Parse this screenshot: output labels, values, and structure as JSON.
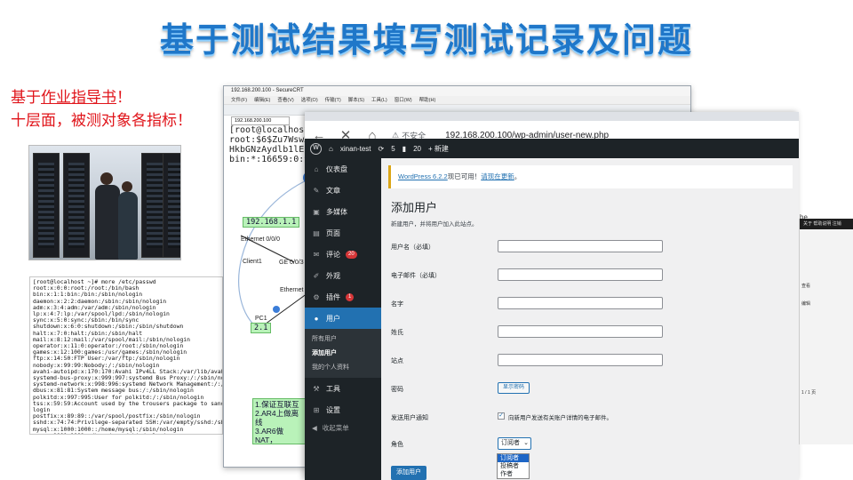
{
  "slide": {
    "title": "基于测试结果填写测试记录及问题",
    "intro_line1_prefix": "基于",
    "intro_line1_link": "作业指导书",
    "intro_line1_suffix": "！",
    "intro_line2": "十层面，被测对象各指标！"
  },
  "terminal_lines": [
    "[root@localhost ~]# more /etc/passwd",
    "root:x:0:0:root:/root:/bin/bash",
    "bin:x:1:1:bin:/bin:/sbin/nologin",
    "daemon:x:2:2:daemon:/sbin:/sbin/nologin",
    "adm:x:3:4:adm:/var/adm:/sbin/nologin",
    "lp:x:4:7:lp:/var/spool/lpd:/sbin/nologin",
    "sync:x:5:0:sync:/sbin:/bin/sync",
    "shutdown:x:6:0:shutdown:/sbin:/sbin/shutdown",
    "halt:x:7:0:halt:/sbin:/sbin/halt",
    "mail:x:8:12:mail:/var/spool/mail:/sbin/nologin",
    "operator:x:11:0:operator:/root:/sbin/nologin",
    "games:x:12:100:games:/usr/games:/sbin/nologin",
    "ftp:x:14:50:FTP User:/var/ftp:/sbin/nologin",
    "nobody:x:99:99:Nobody:/:/sbin/nologin",
    "avahi-autoipd:x:170:170:Avahi IPv4LL Stack:/var/lib/avahi",
    "systemd-bus-proxy:x:999:997:systemd Bus Proxy:/:/sbin/nol",
    "systemd-network:x:998:996:systemd Network Management:/:/",
    "dbus:x:81:81:System message bus:/:/sbin/nologin",
    "polkitd:x:997:995:User for polkitd:/:/sbin/nologin",
    "tss:x:59:59:Account used by the trousers package to sand",
    "login",
    "postfix:x:89:89::/var/spool/postfix:/sbin/nologin",
    "sshd:x:74:74:Privilege-separated SSH:/var/empty/sshd:/sb",
    "mysql:x:1000:1000::/home/mysql:/sbin/nologin",
    "www:x:1001:1001::/home/www:/sbin/nologin",
    "ntp:x:38:38::/etc/ntp:/sbin/nologin",
    "saslauth:x:996:76:Saslauthd user:/run/saslauthd:/sbin/no",
    "[root@localhost ~]# "
  ],
  "securecrt": {
    "title": "192.168.200.100 - SecureCRT",
    "menu": [
      "文件(F)",
      "编辑(E)",
      "查看(V)",
      "选项(O)",
      "传输(T)",
      "脚本(S)",
      "工具(L)",
      "窗口(W)",
      "帮助(H)"
    ],
    "tab": "192.168.200.100",
    "term_text": "[root@localhost ~]# cat\nroot:$6$Zu7WswXx\nHkbGNzAydlb1lEc\nbin:*:16659:0:99\ndaemon:*:16659:0"
  },
  "topology": {
    "ip1": "192.168.1.1",
    "ip2": "2.1",
    "eth1": "Ethernet 0/0/0",
    "client": "Client1",
    "ge": "GE 0/0/3",
    "eth2": "Ethernet",
    "pc": "PC1",
    "tasks": [
      "1.保证互联互",
      "2.AR4上做离线",
      "3.AR6做NAT，",
      "4.设置LSW1使",
      "路由重发布"
    ]
  },
  "browser": {
    "secure_label": "不安全",
    "url": "192.168.200.100/wp-admin/user-new.php",
    "adminbar": {
      "site": "xinan-test",
      "updates": "5",
      "comments": "20",
      "new": "+ 新建"
    },
    "sidebar": [
      {
        "icon": "⌂",
        "label": "仪表盘"
      },
      {
        "icon": "✎",
        "label": "文章"
      },
      {
        "icon": "▣",
        "label": "多媒体"
      },
      {
        "icon": "▤",
        "label": "页面"
      },
      {
        "icon": "✉",
        "label": "评论",
        "badge": "20"
      },
      {
        "icon": "✐",
        "label": "外观"
      },
      {
        "icon": "⚙",
        "label": "插件",
        "badge": "1"
      },
      {
        "icon": "●",
        "label": "用户",
        "active": true
      }
    ],
    "user_submenu": [
      "所有用户",
      "添加用户",
      "我的个人资料"
    ],
    "sidebar_bottom": [
      {
        "icon": "⚒",
        "label": "工具"
      },
      {
        "icon": "⊞",
        "label": "设置"
      }
    ],
    "collapse_label": "收起菜单",
    "notice_link1": "WordPress 6.2.2",
    "notice_text": "现已可用！",
    "notice_link2": "请现在更新",
    "notice_end": "。",
    "page_title": "添加用户",
    "page_desc": "新建用户，并将用户加入此站点。",
    "fields": {
      "username": "用户名（必填）",
      "email": "电子邮件（必填）",
      "firstname": "名字",
      "lastname": "姓氏",
      "website": "站点",
      "password": "密码",
      "show_password": "显示密码",
      "notify": "发送用户通知",
      "notify_text": "向新用户发送有关账户详情的电子邮件。",
      "role": "角色",
      "role_value": "订阅者"
    },
    "role_options": [
      "订阅者",
      "投稿者",
      "作者"
    ],
    "submit_label": "添加用户"
  },
  "right_window": {
    "partial_text": "he",
    "bar_text": "关于 帮助说明 注销",
    "rows": [
      "查看",
      "编辑",
      "",
      "",
      "",
      "",
      "1 / 1 页",
      "",
      ""
    ]
  }
}
